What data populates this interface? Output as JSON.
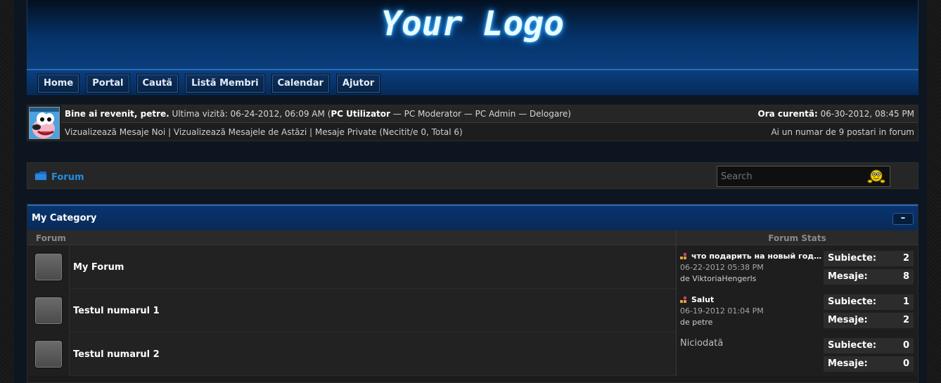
{
  "header": {
    "logo_text": "Your Logo"
  },
  "nav": {
    "items": [
      "Home",
      "Portal",
      "Caută",
      "Listă Membri",
      "Calendar",
      "Ajutor"
    ]
  },
  "userbar": {
    "welcome": "Bine ai revenit, petre.",
    "last_visit": " Ultima vizită: 06-24-2012, 06:09 AM (",
    "pc_user": "PC Utilizator",
    "links_rest": " — PC Moderator — PC Admin — Delogare)",
    "current_time_label": "Ora curentă:",
    "current_time": " 06-30-2012, 08:45 PM",
    "links_row2": "Vizualizează Mesaje Noi | Vizualizează Mesajele de Astăzi | Mesaje Private (Necitit/e 0, Total 6)",
    "posts_info": "Ai un numar de 9 postari in forum"
  },
  "breadcrumb": {
    "label": "Forum"
  },
  "search": {
    "placeholder": "Search"
  },
  "category": {
    "title": "My Category",
    "collapse_label": "–",
    "col_forum": "Forum",
    "col_stats": "Forum Stats",
    "forums": [
      {
        "name": "My Forum",
        "last_title": "что подарить на новый год…",
        "last_date": "06-22-2012 05:38 PM",
        "last_by": "de ViktoriaHengerls",
        "never": "",
        "subjects_label": "Subiecte:",
        "subjects": "2",
        "posts_label": "Mesaje:",
        "posts": "8"
      },
      {
        "name": "Testul numarul 1",
        "last_title": "Salut",
        "last_date": "06-19-2012 01:04 PM",
        "last_by": "de petre",
        "never": "",
        "subjects_label": "Subiecte:",
        "subjects": "1",
        "posts_label": "Mesaje:",
        "posts": "2"
      },
      {
        "name": "Testul numarul 2",
        "last_title": "",
        "last_date": "",
        "last_by": "",
        "never": "Niciodată",
        "subjects_label": "Subiecte:",
        "subjects": "0",
        "posts_label": "Mesaje:",
        "posts": "0"
      }
    ]
  }
}
